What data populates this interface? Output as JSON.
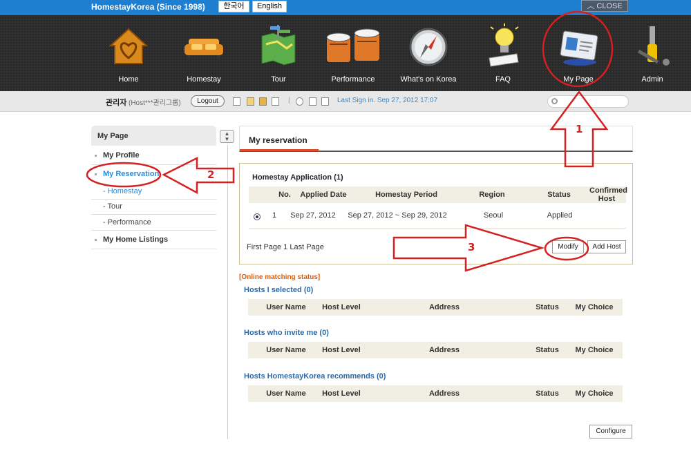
{
  "header": {
    "brand": "HomestayKorea (Since 1998)",
    "lang_ko": "한국어",
    "lang_en": "English",
    "close": "CLOSE"
  },
  "nav": {
    "items": [
      {
        "label": "Home",
        "icon": "house-icon"
      },
      {
        "label": "Homestay",
        "icon": "sofa-icon"
      },
      {
        "label": "Tour",
        "icon": "map-icon"
      },
      {
        "label": "Performance",
        "icon": "drums-icon"
      },
      {
        "label": "What's on Korea",
        "icon": "compass-icon"
      },
      {
        "label": "FAQ",
        "icon": "lightbulb-icon"
      },
      {
        "label": "My Page",
        "icon": "id-card-icon"
      },
      {
        "label": "Admin",
        "icon": "tools-icon"
      }
    ]
  },
  "userbar": {
    "name": "관리자",
    "group": "(Host***관리그룹)",
    "logout": "Logout",
    "separator": "|",
    "last_sign": "Last Sign in. Sep 27, 2012 17:07"
  },
  "sidebar": {
    "title": "My Page",
    "items": [
      {
        "label": "My Profile"
      },
      {
        "label": "My Reservation",
        "active": true
      },
      {
        "label": "My Home Listings"
      }
    ],
    "sub_items": [
      "- Homestay",
      "- Tour",
      "- Performance"
    ]
  },
  "main": {
    "tab": "My reservation",
    "application_title": "Homestay Application (1)",
    "columns": [
      "No.",
      "Applied Date",
      "Homestay Period",
      "Region",
      "Status",
      "Confirmed Host"
    ],
    "rows": [
      {
        "no": "1",
        "applied": "Sep 27, 2012",
        "period": "Sep 27, 2012 ~ Sep 29, 2012",
        "region": "Seoul",
        "status": "Applied",
        "host": ""
      }
    ],
    "pager": "First Page 1 Last Page",
    "modify": "Modify",
    "add_host": "Add Host"
  },
  "matching": {
    "title": "[Online matching status]",
    "sections": [
      {
        "title": "Hosts I selected (0)"
      },
      {
        "title": "Hosts who invite me (0)"
      },
      {
        "title": "Hosts HomestayKorea recommends (0)"
      }
    ],
    "columns": [
      "User Name",
      "Host Level",
      "Address",
      "Status",
      "My Choice"
    ],
    "configure": "Configure"
  },
  "annotations": {
    "n1": "1",
    "n2": "2",
    "n3": "3",
    "color": "#d42020"
  }
}
